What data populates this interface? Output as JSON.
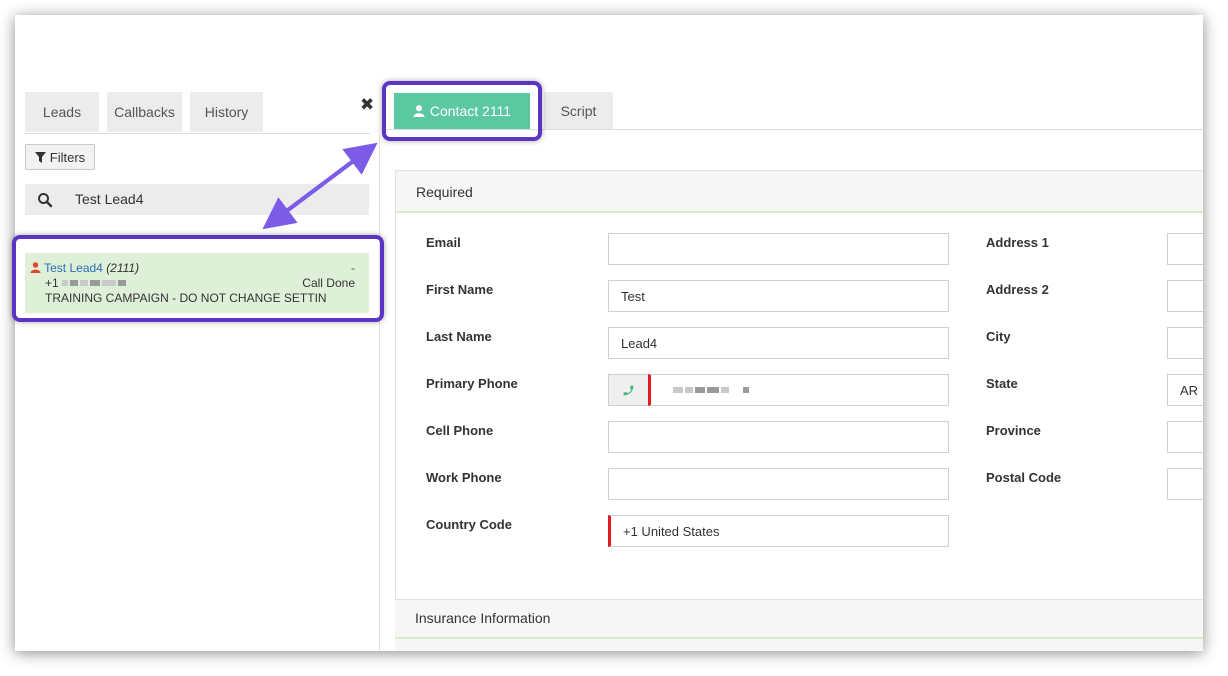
{
  "left_tabs": {
    "leads": "Leads",
    "callbacks": "Callbacks",
    "history": "History"
  },
  "close_label": "✖",
  "filters_label": "Filters",
  "search": {
    "value": "Test Lead4"
  },
  "lead": {
    "name": "Test Lead4",
    "id": "(2111)",
    "dash": "-",
    "phone_prefix": "+1",
    "status": "Call Done",
    "campaign": "TRAINING CAMPAIGN - DO NOT CHANGE SETTIN"
  },
  "right_tabs": {
    "contact": "Contact 2111",
    "script": "Script"
  },
  "section_required": {
    "title": "Required",
    "left_fields": [
      {
        "label": "Email",
        "value": ""
      },
      {
        "label": "First Name",
        "value": "Test"
      },
      {
        "label": "Last Name",
        "value": "Lead4"
      },
      {
        "label": "Primary Phone",
        "value": ""
      },
      {
        "label": "Cell Phone",
        "value": ""
      },
      {
        "label": "Work Phone",
        "value": ""
      },
      {
        "label": "Country Code",
        "value": "+1 United States"
      }
    ],
    "right_fields": [
      {
        "label": "Address 1",
        "value": ""
      },
      {
        "label": "Address 2",
        "value": ""
      },
      {
        "label": "City",
        "value": ""
      },
      {
        "label": "State",
        "value": "AR"
      },
      {
        "label": "Province",
        "value": ""
      },
      {
        "label": "Postal Code",
        "value": ""
      }
    ]
  },
  "section_insurance": {
    "title": "Insurance Information"
  },
  "colors": {
    "accent_green": "#5bc8a1",
    "lead_bg": "#dff0d8",
    "highlight_purple": "#5b34c4",
    "required_red": "#e31b23",
    "link_blue": "#2a6fb4"
  }
}
